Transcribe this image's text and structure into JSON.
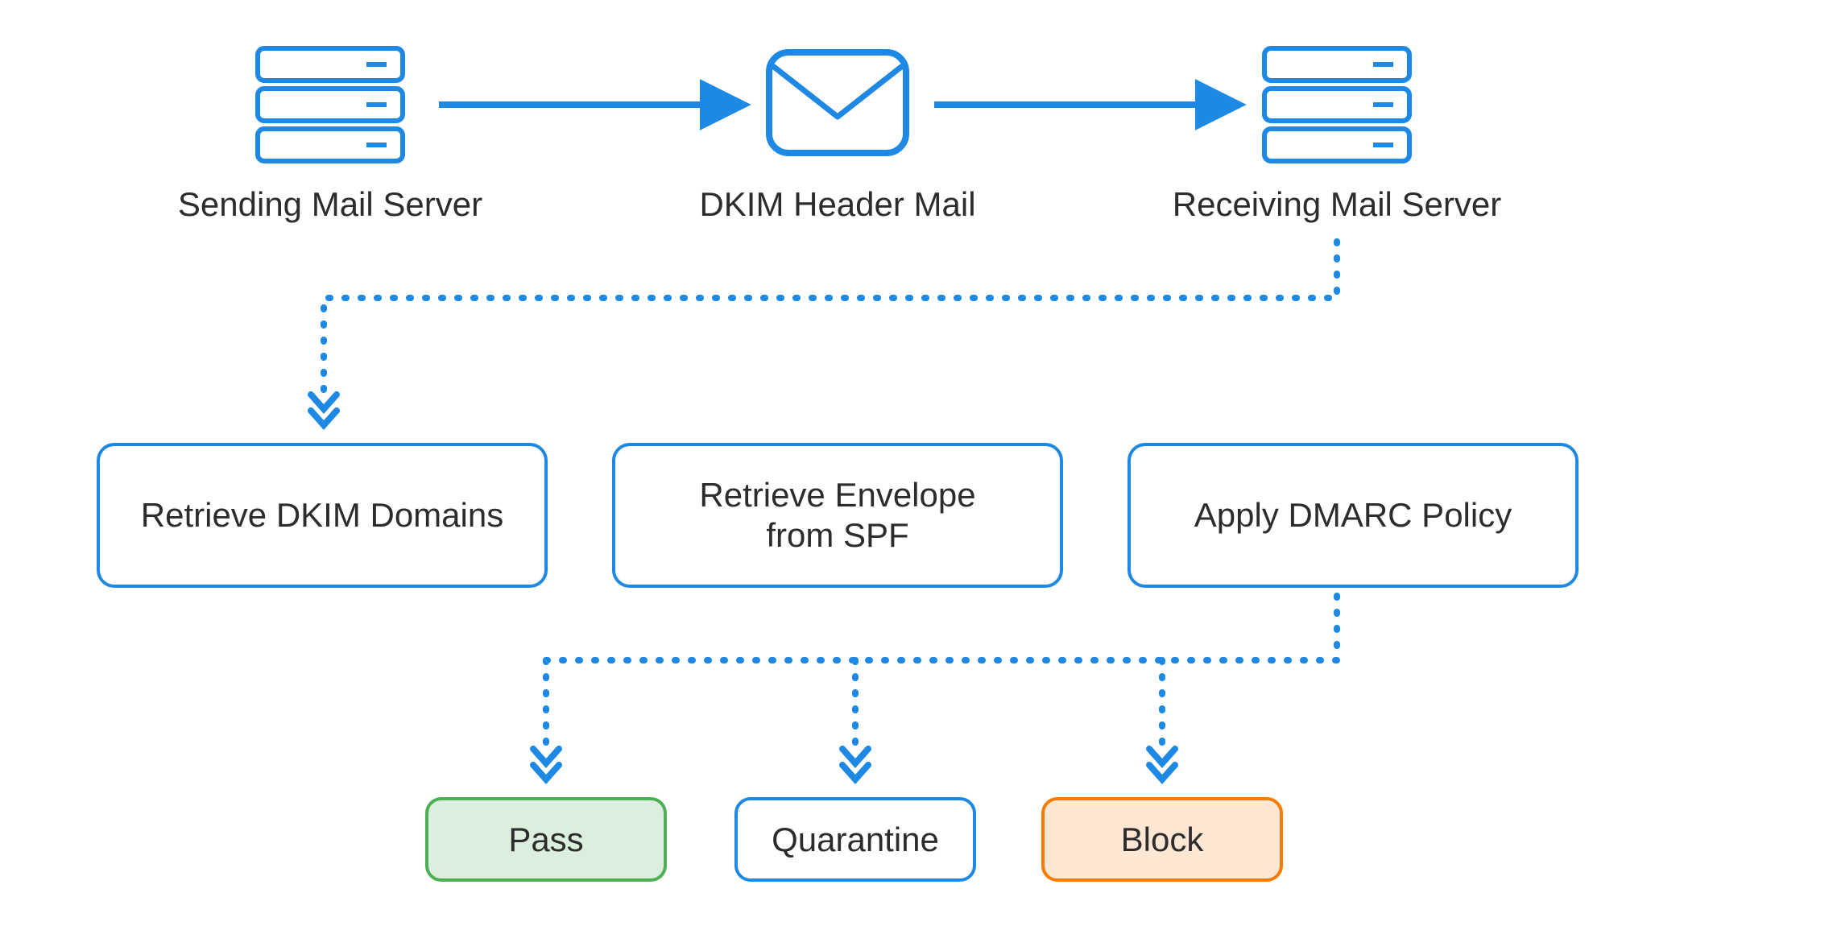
{
  "top": {
    "sending": {
      "label": "Sending Mail Server"
    },
    "dkim": {
      "label": "DKIM Header Mail"
    },
    "receiving": {
      "label": "Receiving Mail Server"
    }
  },
  "process": {
    "retrieve_dkim": "Retrieve DKIM Domains",
    "retrieve_spf": "Retrieve Envelope\nfrom SPF",
    "apply_dmarc": "Apply DMARC Policy"
  },
  "outcomes": {
    "pass": "Pass",
    "quarantine": "Quarantine",
    "block": "Block"
  },
  "colors": {
    "blue": "#1e88e5",
    "green_border": "#4caf50",
    "green_fill": "#dceedd",
    "orange_border": "#f57c00",
    "orange_fill": "#ffe7d4"
  }
}
